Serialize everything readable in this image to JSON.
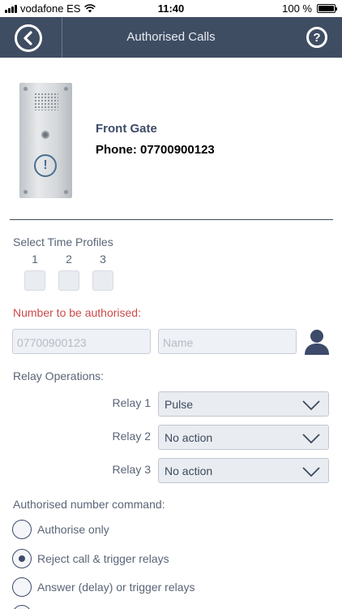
{
  "status_bar": {
    "carrier": "vodafone ES",
    "time": "11:40",
    "battery": "100 %",
    "battery_level": 1.0
  },
  "header": {
    "title": "Authorised Calls",
    "back_icon": "chevron-left-icon",
    "help_icon": "help-icon",
    "help_glyph": "?"
  },
  "device": {
    "name": "Front Gate",
    "phone": "Phone: 07700900123",
    "alert_glyph": "!"
  },
  "time_profiles": {
    "label": "Select Time Profiles",
    "items": [
      {
        "number": "1",
        "checked": false
      },
      {
        "number": "2",
        "checked": false
      },
      {
        "number": "3",
        "checked": false
      }
    ]
  },
  "number_section": {
    "label": "Number to be authorised:",
    "number_placeholder": "07700900123",
    "name_placeholder": "Name",
    "contact_icon": "contact-person-icon"
  },
  "relay_operations": {
    "label": "Relay Operations:",
    "relays": [
      {
        "label": "Relay 1",
        "value": "Pulse"
      },
      {
        "label": "Relay 2",
        "value": "No action"
      },
      {
        "label": "Relay 3",
        "value": "No action"
      }
    ]
  },
  "command": {
    "label": "Authorised number command:",
    "options": [
      {
        "label": "Authorise only",
        "selected": false
      },
      {
        "label": "Reject call & trigger relays",
        "selected": true
      },
      {
        "label": "Answer (delay) or trigger relays",
        "selected": false
      }
    ]
  },
  "colors": {
    "header_bg": "#3f4d63",
    "accent_red": "#cc4a4a",
    "navy": "#3d4a6a"
  }
}
